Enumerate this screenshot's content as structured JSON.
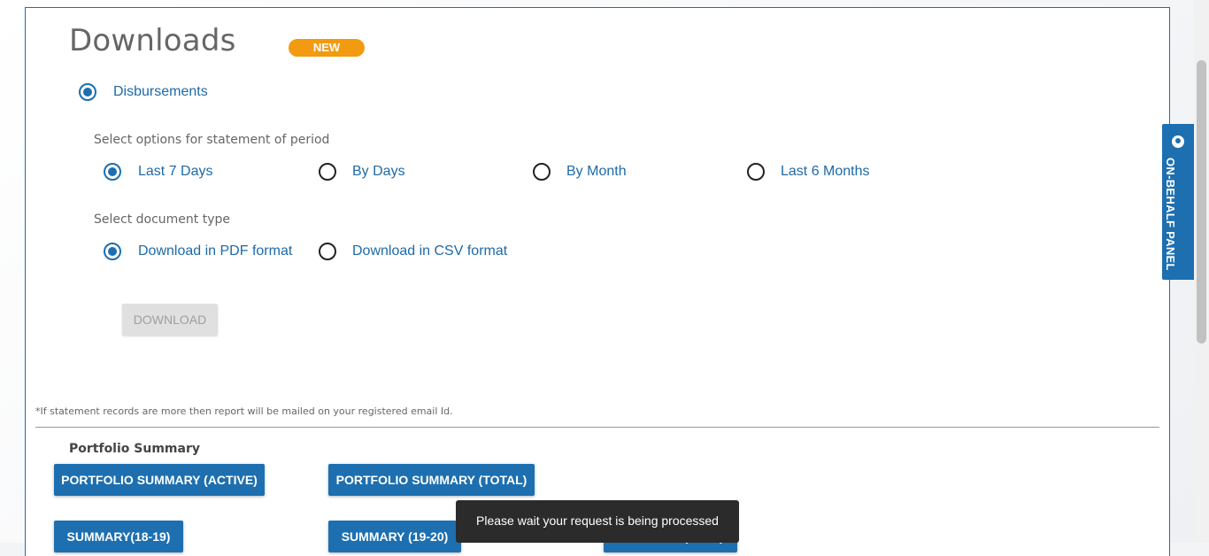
{
  "header": {
    "title": "Downloads",
    "badge": "NEW"
  },
  "category": {
    "label": "Disbursements",
    "selected": true
  },
  "period": {
    "prompt": "Select options for statement of period",
    "options": [
      {
        "label": "Last 7 Days",
        "selected": true
      },
      {
        "label": "By Days",
        "selected": false
      },
      {
        "label": "By Month",
        "selected": false
      },
      {
        "label": "Last 6 Months",
        "selected": false
      }
    ]
  },
  "doctype": {
    "prompt": "Select document type",
    "options": [
      {
        "label": "Download in PDF format",
        "selected": true
      },
      {
        "label": "Download in CSV format",
        "selected": false
      }
    ]
  },
  "download_button": "DOWNLOAD",
  "note": "*If statement records are more then report will be mailed on your registered email Id.",
  "portfolio": {
    "title": "Portfolio Summary",
    "buttons": [
      "PORTFOLIO SUMMARY (ACTIVE)",
      "PORTFOLIO SUMMARY (TOTAL)",
      "SUMMARY(18-19)",
      "SUMMARY (19-20)",
      "SUMMARY (20-21)"
    ]
  },
  "toast": "Please wait your request is being processed",
  "side_panel": {
    "label": "ON-BEHALF PANEL"
  },
  "colors": {
    "primary": "#1d6fb0",
    "badge": "#f29b11",
    "toast": "#2b2b2b"
  }
}
